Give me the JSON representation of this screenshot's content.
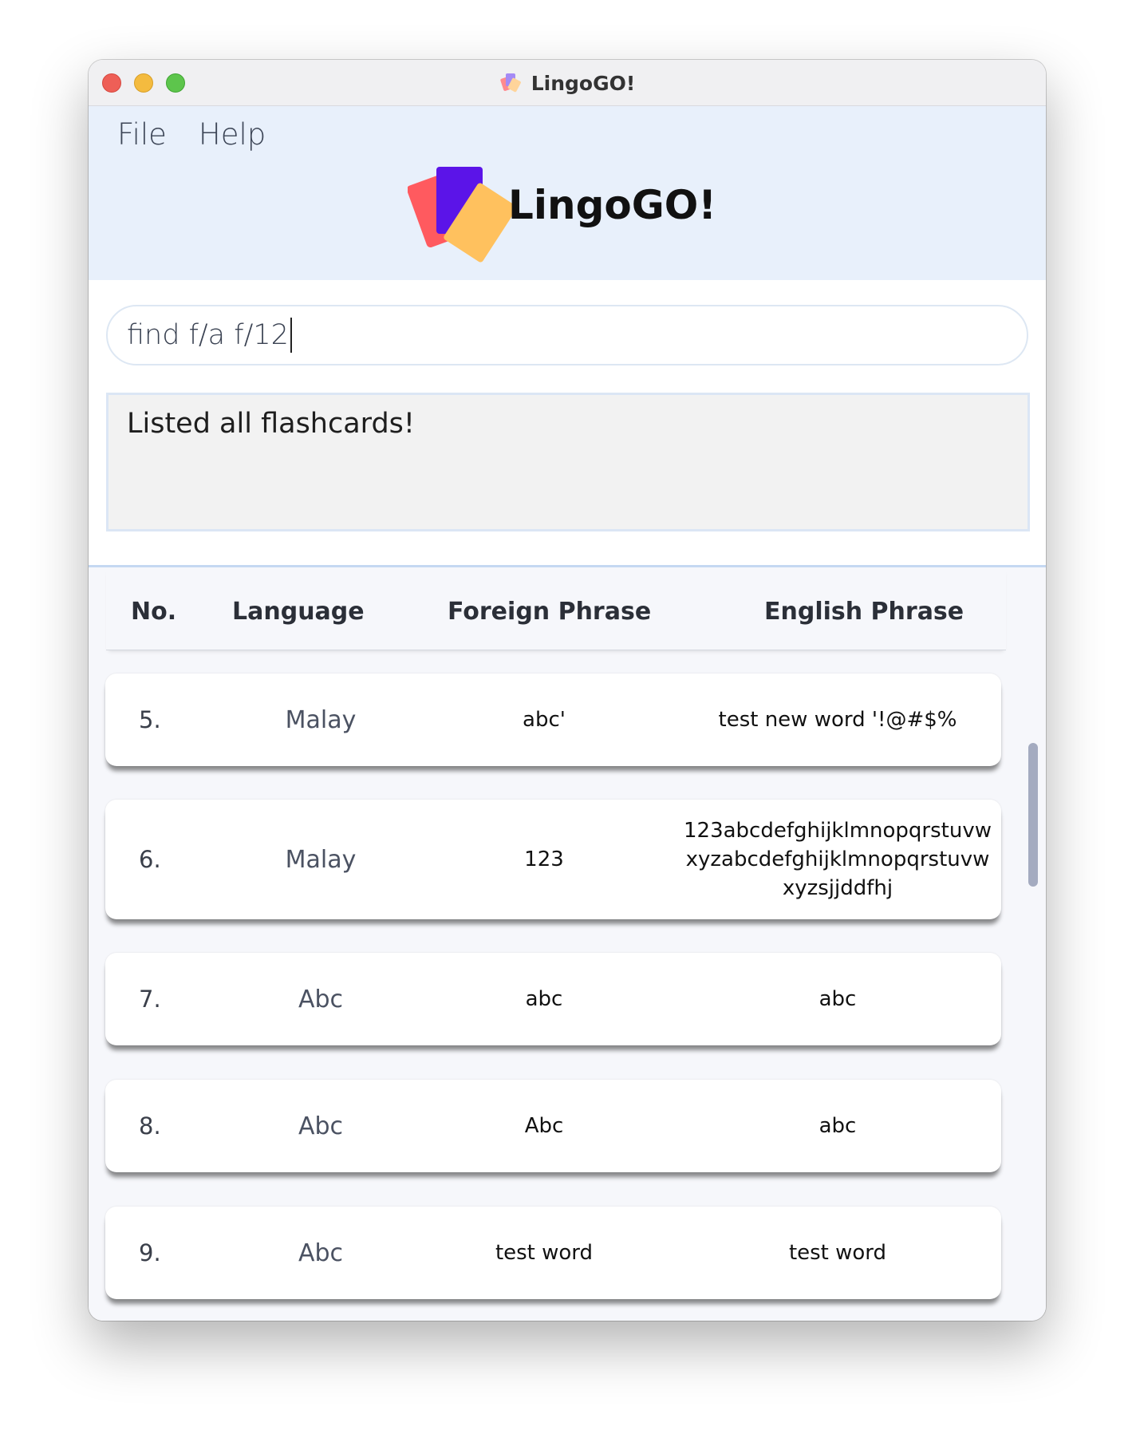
{
  "window": {
    "title": "LingoGO!",
    "icon": "stacked-cards-icon"
  },
  "menu": {
    "file_label": "File",
    "help_label": "Help"
  },
  "logo": {
    "text": "LingoGO!",
    "colors": [
      "#ff5a5f",
      "#5b14e8",
      "#ffc15e"
    ]
  },
  "command": {
    "value": "find f/a f/12"
  },
  "result": {
    "message": "Listed all flashcards!"
  },
  "table": {
    "headers": {
      "no": "No.",
      "language": "Language",
      "foreign": "Foreign Phrase",
      "english": "English Phrase"
    },
    "rows": [
      {
        "no": "5.",
        "language": "Malay",
        "foreign": "abc'",
        "english": "test new word '!@#$%"
      },
      {
        "no": "6.",
        "language": "Malay",
        "foreign": "123",
        "english": "123abcdefghijklmnopqrstuvw\nxyzabcdefghijklmnopqrstuvw\nxyzsjjddfhj"
      },
      {
        "no": "7.",
        "language": "Abc",
        "foreign": "abc",
        "english": "abc"
      },
      {
        "no": "8.",
        "language": "Abc",
        "foreign": "Abc",
        "english": "abc"
      },
      {
        "no": "9.",
        "language": "Abc",
        "foreign": "test word",
        "english": "test word"
      }
    ]
  },
  "colors": {
    "header_bg": "#e8f0fb",
    "list_bg": "#f6f7fb",
    "result_bg": "#f2f2f2"
  }
}
